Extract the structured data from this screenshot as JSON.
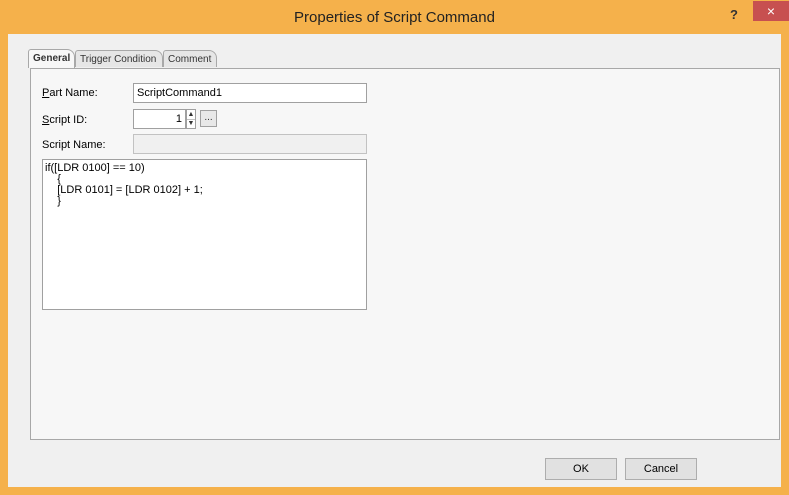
{
  "window": {
    "title": "Properties of Script Command",
    "help_label": "?",
    "close_label": "×"
  },
  "tabs": [
    {
      "label": "General",
      "active": true
    },
    {
      "label": "Trigger Condition",
      "active": false
    },
    {
      "label": "Comment",
      "active": false
    }
  ],
  "form": {
    "part_name": {
      "label_access": "P",
      "label_rest": "art Name:",
      "value": "ScriptCommand1"
    },
    "script_id": {
      "label_access": "S",
      "label_rest": "cript ID:",
      "value": "1",
      "browse_label": "..."
    },
    "script_name": {
      "label": "Script Name:",
      "value": ""
    },
    "script_lines": [
      "if([LDR 0100] == 10)",
      "    {",
      "    [LDR 0101] = [LDR 0102] + 1;",
      "    }"
    ]
  },
  "buttons": {
    "ok": "OK",
    "cancel": "Cancel"
  },
  "colors": {
    "titlebar": "#f5b14b",
    "close": "#c75050",
    "panel": "#f7f7f7"
  }
}
